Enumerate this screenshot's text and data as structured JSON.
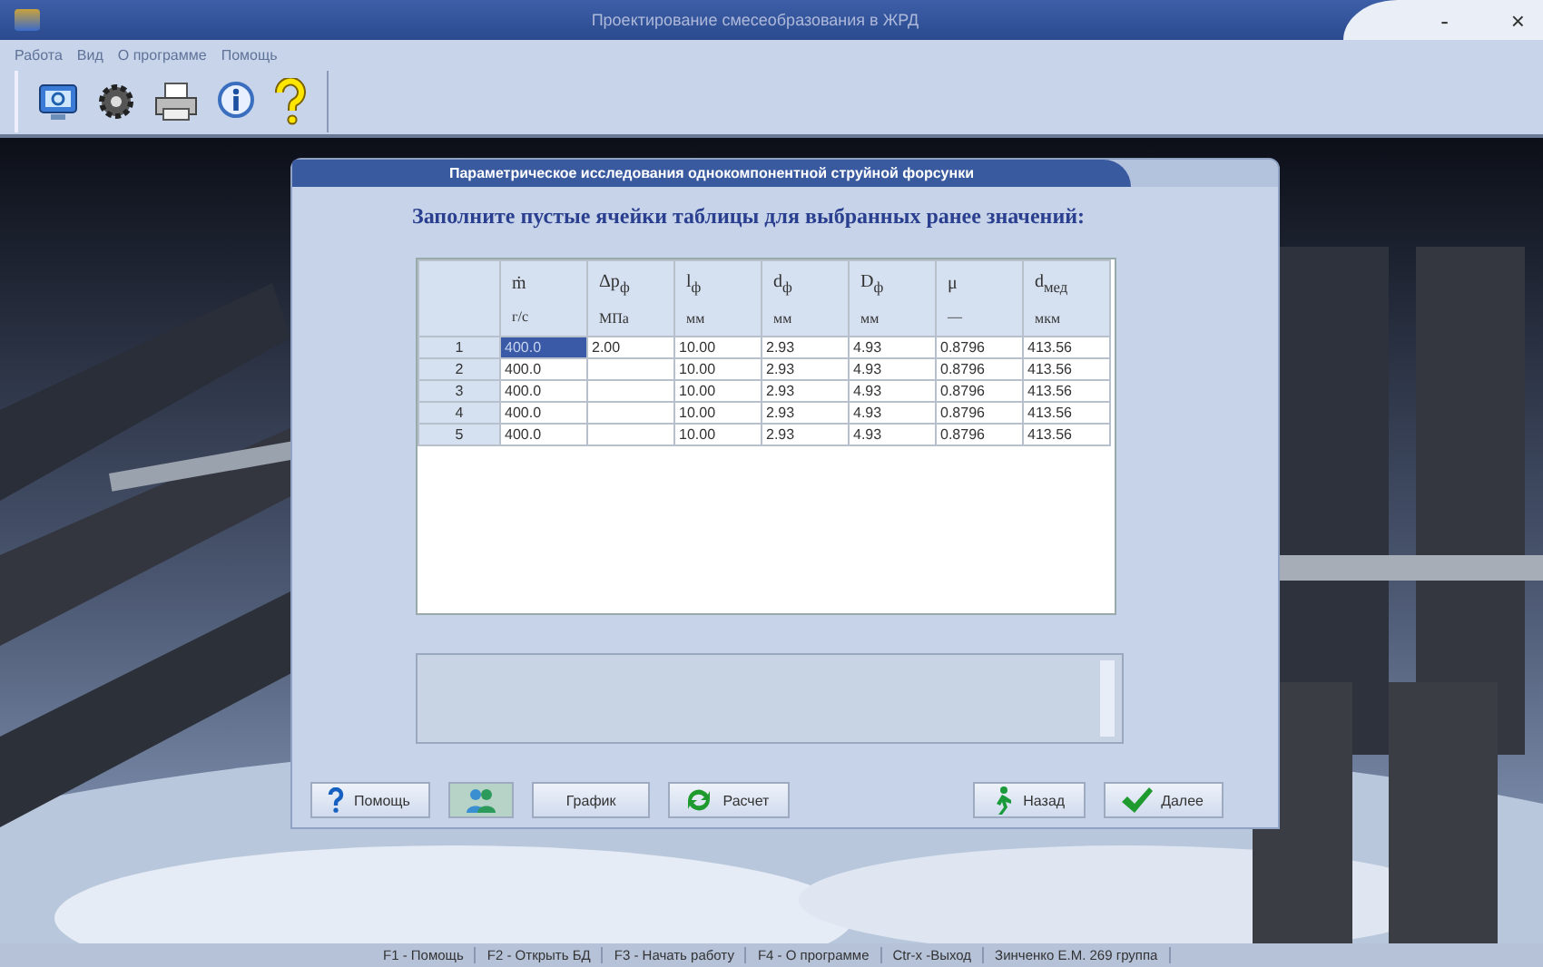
{
  "window": {
    "title": "Проектирование смесеобразования в ЖРД",
    "controls": [
      "-",
      "×"
    ]
  },
  "menu": [
    {
      "label": "Работа",
      "disabled": true
    },
    {
      "label": "Вид",
      "disabled": true
    },
    {
      "label": "О программе",
      "disabled": true
    },
    {
      "label": "Помощь",
      "disabled": true
    }
  ],
  "toolbar": [
    {
      "kind": "monitor"
    },
    {
      "kind": "gear"
    },
    {
      "kind": "printer"
    },
    {
      "kind": "info"
    },
    {
      "kind": "help"
    }
  ],
  "background": {
    "kind": "picture"
  },
  "dialog": {
    "title": "Параметрическое исследования однокомпонентной струйной форсунки",
    "instruction": "Заполните пустые ячейки таблицы для выбранных ранее значений:",
    "table": {
      "columns": [
        {
          "symbol": "ṁ",
          "unit": "г/с"
        },
        {
          "symbol": "Δp$_{ф}$",
          "unit": "МПа"
        },
        {
          "symbol": "l$_{ф}$",
          "unit": "мм"
        },
        {
          "symbol": "d$_{ф}$",
          "unit": "мм"
        },
        {
          "symbol": "D$_{ф}$",
          "unit": "мм"
        },
        {
          "symbol": "μ",
          "unit": "—"
        },
        {
          "symbol": "d$_{мед}$",
          "unit": "мкм"
        }
      ],
      "rows": [
        {
          "number": "1",
          "selected": true,
          "cells": [
            "400.0",
            "2.00",
            "10.00",
            "2.93",
            "4.93",
            "0.8796",
            "413.56"
          ]
        },
        {
          "number": "2",
          "selected": false,
          "cells": [
            "400.0",
            null,
            "10.00",
            "2.93",
            "4.93",
            "0.8796",
            "413.56"
          ]
        },
        {
          "number": "3",
          "selected": false,
          "cells": [
            "400.0",
            null,
            "10.00",
            "2.93",
            "4.93",
            "0.8796",
            "413.56"
          ]
        },
        {
          "number": "4",
          "selected": false,
          "cells": [
            "400.0",
            null,
            "10.00",
            "2.93",
            "4.93",
            "0.8796",
            "413.56"
          ]
        },
        {
          "number": "5",
          "selected": false,
          "cells": [
            "400.0",
            null,
            "10.00",
            "2.93",
            "4.93",
            "0.8796",
            "413.56"
          ]
        }
      ]
    },
    "buttons": [
      {
        "kind": "help",
        "label": "Помощь"
      },
      {
        "kind": "people"
      },
      {
        "kind": "plain",
        "label": "График"
      },
      {
        "kind": "refresh",
        "label": "Расчет"
      },
      {
        "kind": "spacer"
      },
      {
        "kind": "back",
        "label": "Назад"
      },
      {
        "kind": "ok",
        "label": "Далее"
      }
    ]
  },
  "status_bar": [
    "F1 - Помощь",
    "F2 - Открыть БД",
    "F3 - Начать работу",
    "F4 - О программе",
    "Ctr-x -Выход",
    "Зинченко Е.М. 269 группа"
  ]
}
